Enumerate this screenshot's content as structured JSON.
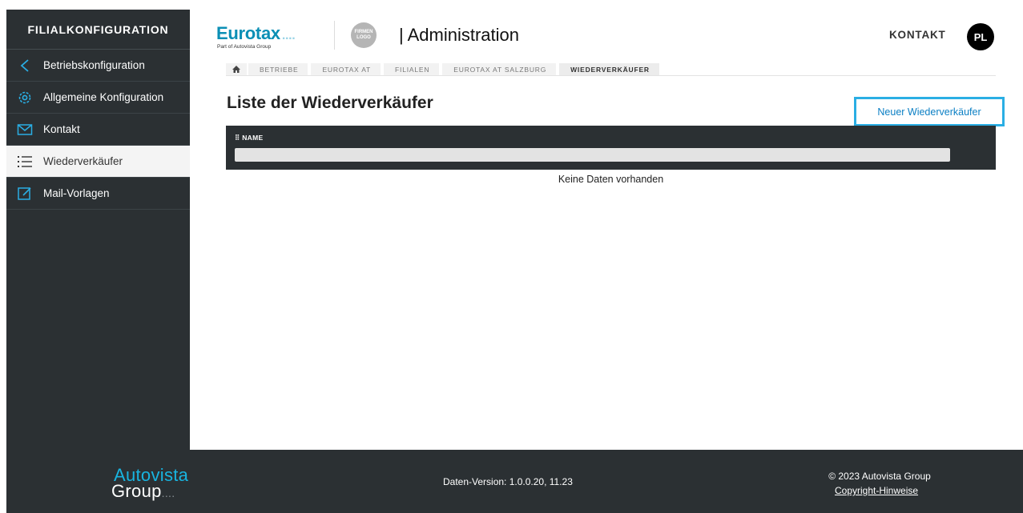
{
  "sidebar": {
    "title": "FILIALKONFIGURATION",
    "items": [
      {
        "label": "Betriebskonfiguration",
        "icon": "chevron-left-icon"
      },
      {
        "label": "Allgemeine Konfiguration",
        "icon": "gear-icon"
      },
      {
        "label": "Kontakt",
        "icon": "envelope-icon"
      },
      {
        "label": "Wiederverkäufer",
        "icon": "list-icon"
      },
      {
        "label": "Mail-Vorlagen",
        "icon": "edit-icon"
      }
    ]
  },
  "header": {
    "logo": "Eurotax",
    "logo_sub": "Part of Autovista Group",
    "firm_logo": "FIRMEN LOGO",
    "title": "| Administration",
    "contact": "KONTAKT",
    "avatar": "PL"
  },
  "breadcrumb": {
    "items": [
      "BETRIEBE",
      "EUROTAX AT",
      "FILIALEN",
      "EUROTAX AT SALZBURG",
      "WIEDERVERKÄUFER"
    ]
  },
  "main": {
    "title": "Liste der Wiederverkäufer",
    "new_button": "Neuer Wiederverkäufer",
    "column_name": "NAME",
    "empty_text": "Keine Daten vorhanden"
  },
  "footer": {
    "logo_line1": "Autovista",
    "logo_line2": "Group",
    "data_version": "Daten-Version: 1.0.0.20, 11.23",
    "copyright": "© 2023 Autovista Group",
    "copyright_link": "Copyright-Hinweise"
  },
  "colors": {
    "sidebar_bg": "#2b3033",
    "accent": "#0b8fb5",
    "button_border": "#2aaee4"
  }
}
